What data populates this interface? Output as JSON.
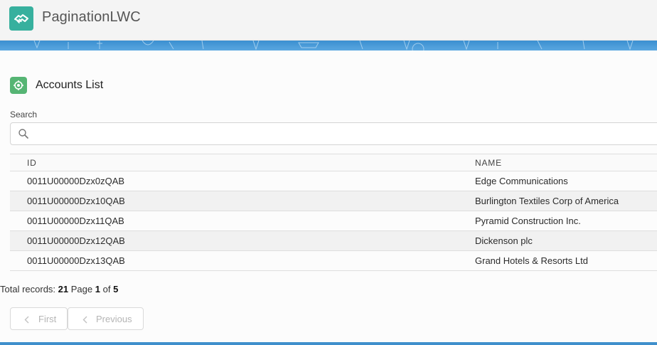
{
  "app": {
    "title": "PaginationLWC",
    "logo_icon": "handshake-icon",
    "accent": "#37b09e"
  },
  "card": {
    "title": "Accounts List",
    "icon": "account-icon"
  },
  "search": {
    "label": "Search",
    "value": "",
    "placeholder": ""
  },
  "table": {
    "columns": [
      "ID",
      "NAME"
    ],
    "rows": [
      {
        "id": "0011U00000Dzx0zQAB",
        "name": "Edge Communications"
      },
      {
        "id": "0011U00000Dzx10QAB",
        "name": "Burlington Textiles Corp of America"
      },
      {
        "id": "0011U00000Dzx11QAB",
        "name": "Pyramid Construction Inc."
      },
      {
        "id": "0011U00000Dzx12QAB",
        "name": "Dickenson plc"
      },
      {
        "id": "0011U00000Dzx13QAB",
        "name": "Grand Hotels & Resorts Ltd"
      }
    ]
  },
  "pagination": {
    "total_label": "Total records:",
    "total": "21",
    "page_label": "Page",
    "page": "1",
    "of_label": "of",
    "pages": "5",
    "first_label": "First",
    "previous_label": "Previous"
  }
}
